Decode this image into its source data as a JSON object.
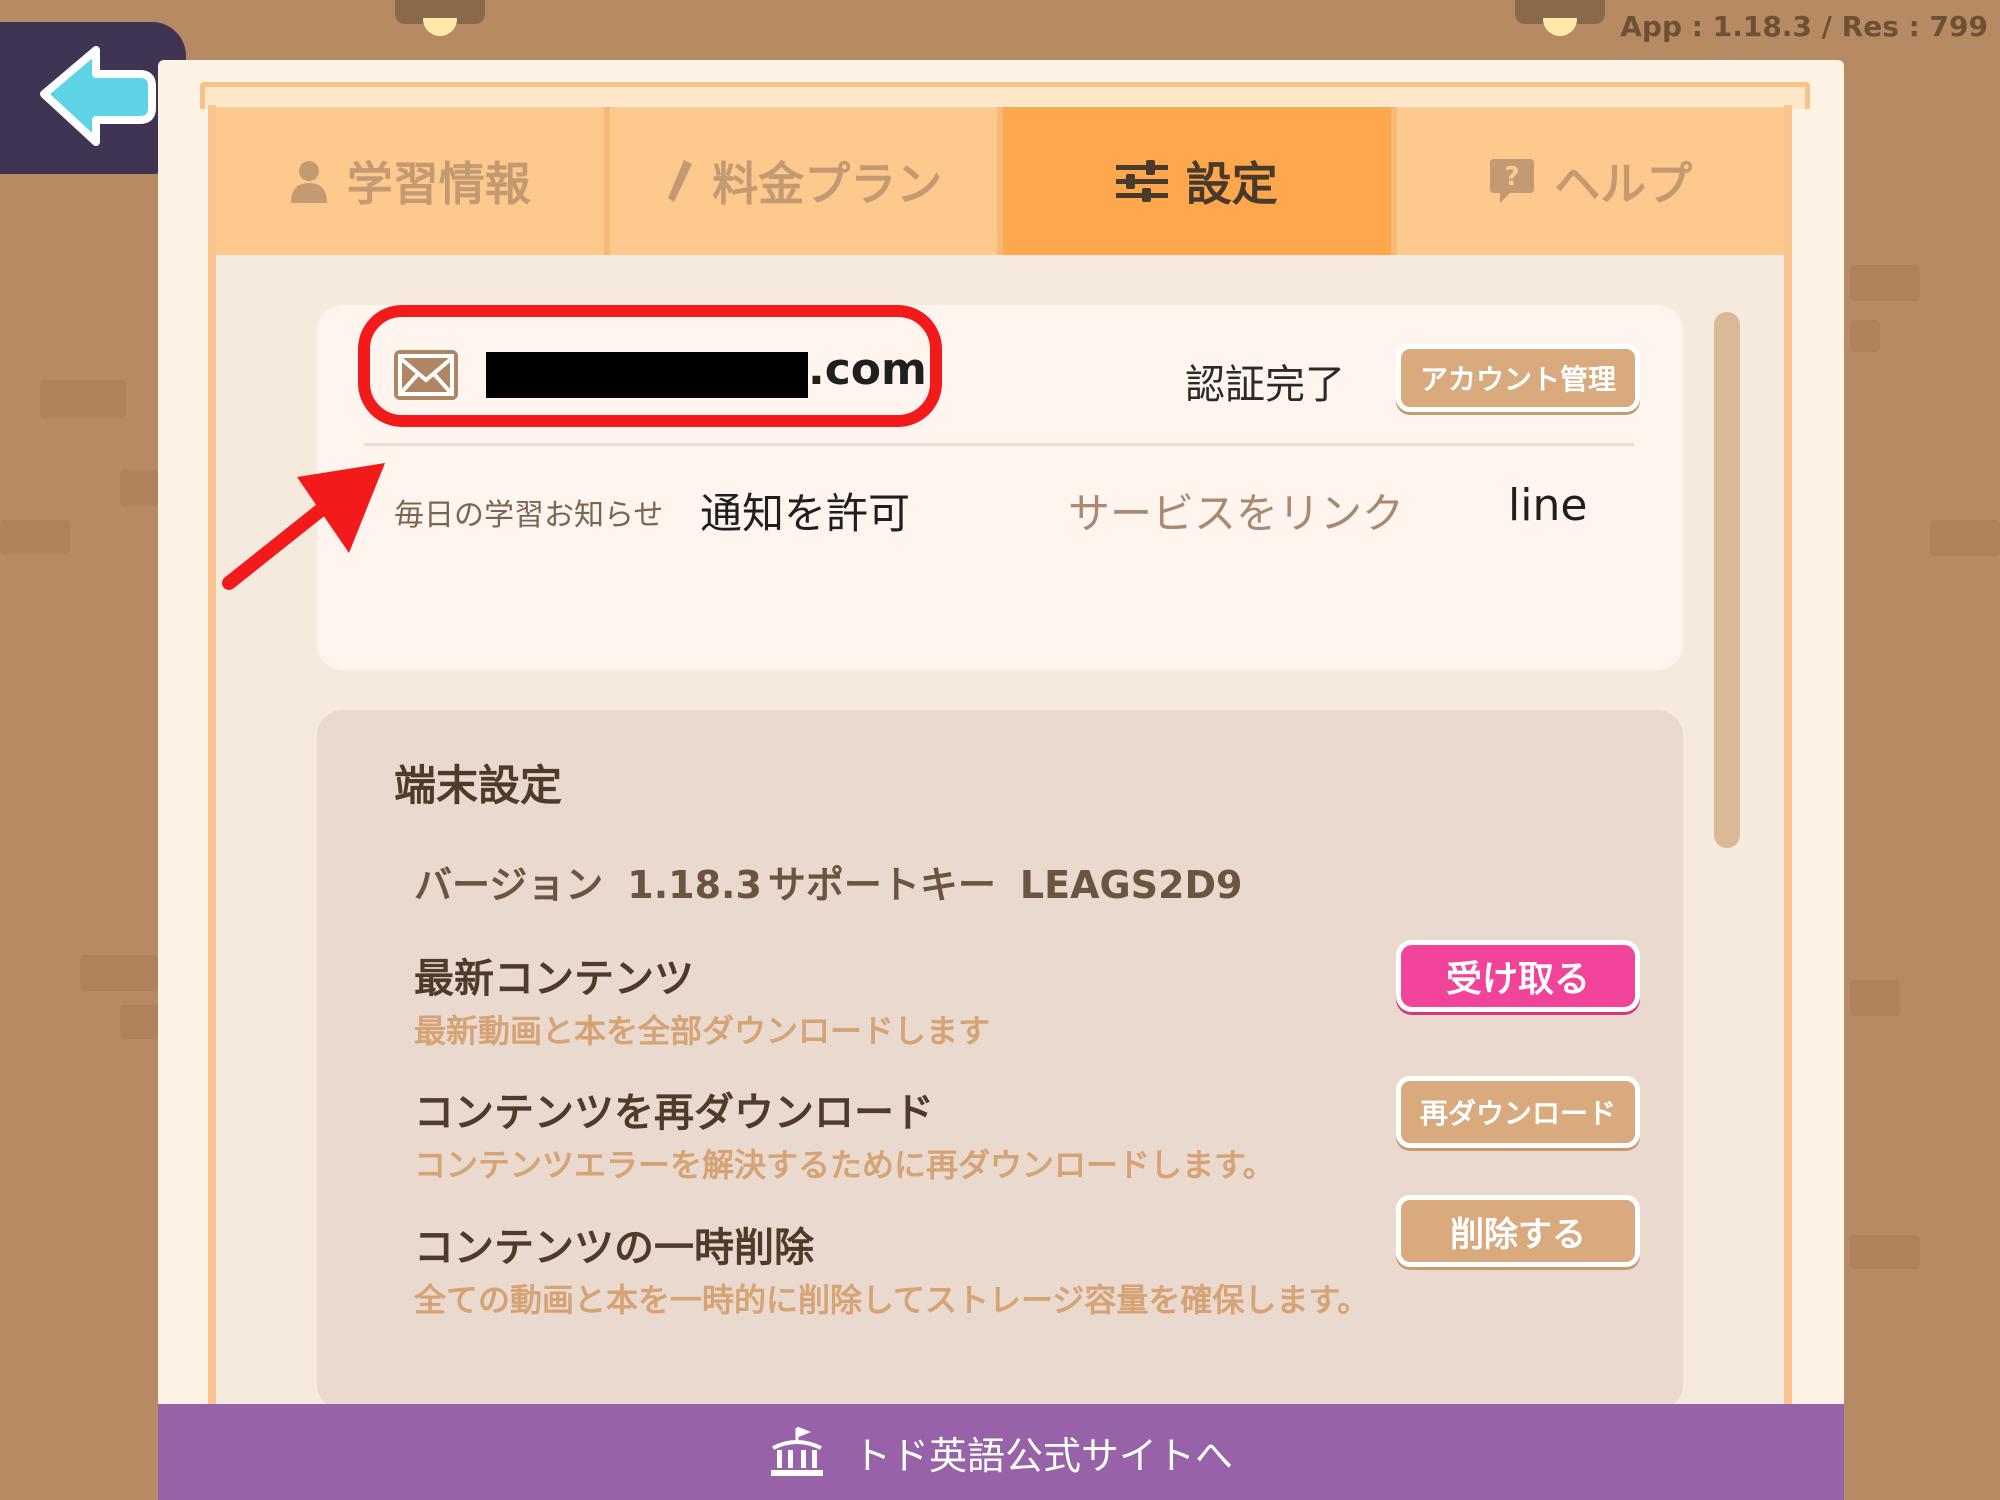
{
  "app": {
    "version_label": "App : 1.18.3 / Res : 799"
  },
  "tabs": [
    {
      "label": "学習情報",
      "icon": "person-icon",
      "active": false
    },
    {
      "label": "料金プラン",
      "icon": "pen-icon",
      "active": false
    },
    {
      "label": "設定",
      "icon": "sliders-icon",
      "active": true
    },
    {
      "label": "ヘルプ",
      "icon": "question-bubble-icon",
      "active": false
    }
  ],
  "account": {
    "email_suffix": ".com",
    "status": "認証完了",
    "manage_button": "アカウント管理",
    "notification_label": "毎日の学習お知らせ",
    "notification_value": "通知を許可",
    "link_label": "サービスをリンク",
    "link_value": "line"
  },
  "device_settings": {
    "title": "端末設定",
    "version_label": "バージョン",
    "version_value": "1.18.3",
    "support_key_label": "サポートキー",
    "support_key_value": "LEAGS2D9",
    "items": [
      {
        "title": "最新コンテンツ",
        "description": "最新動画と本を全部ダウンロードします",
        "button": "受け取る",
        "button_style": "pink"
      },
      {
        "title": "コンテンツを再ダウンロード",
        "description": "コンテンツエラーを解決するために再ダウンロードします。",
        "button": "再ダウンロード",
        "button_style": "tan"
      },
      {
        "title": "コンテンツの一時削除",
        "description": "全ての動画と本を一時的に削除してストレージ容量を確保します。",
        "button": "削除する",
        "button_style": "tan"
      }
    ]
  },
  "footer": {
    "link_label": "トド英語公式サイトへ"
  },
  "colors": {
    "active_tab": "#ffa74c",
    "inactive_tab": "#fdc98d",
    "pink_button": "#f2439a",
    "tan_button": "#d8aa7e",
    "footer": "#9862a8",
    "annotation": "#f21a1a"
  }
}
